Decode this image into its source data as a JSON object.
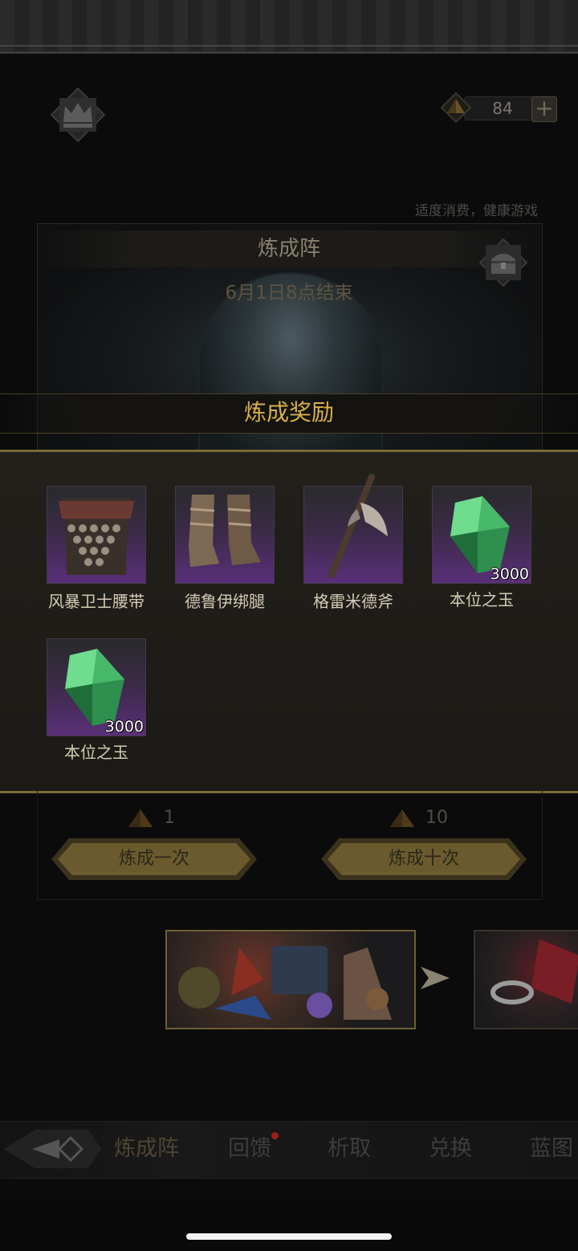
{
  "currency": {
    "value": "84",
    "plus": "+"
  },
  "notice": "适度消费，健康游戏",
  "panel": {
    "title": "炼成阵",
    "end_time": "6月1日8点结束"
  },
  "rewards": {
    "title": "炼成奖励",
    "items": [
      {
        "name": "风暴卫士腰带",
        "count": ""
      },
      {
        "name": "德鲁伊绑腿",
        "count": ""
      },
      {
        "name": "格雷米德斧",
        "count": ""
      },
      {
        "name": "本位之玉",
        "count": "3000"
      },
      {
        "name": "本位之玉",
        "count": "3000"
      }
    ]
  },
  "actions": {
    "once": {
      "cost": "1",
      "label": "炼成一次"
    },
    "ten": {
      "cost": "10",
      "label": "炼成十次"
    }
  },
  "nav": {
    "tabs": [
      "炼成阵",
      "回馈",
      "析取",
      "兑换",
      "蓝图"
    ]
  },
  "colors": {
    "accent_gold": "#d9b04a",
    "rarity_purple": "#5a2f78",
    "notify_red": "#a01c1c"
  }
}
